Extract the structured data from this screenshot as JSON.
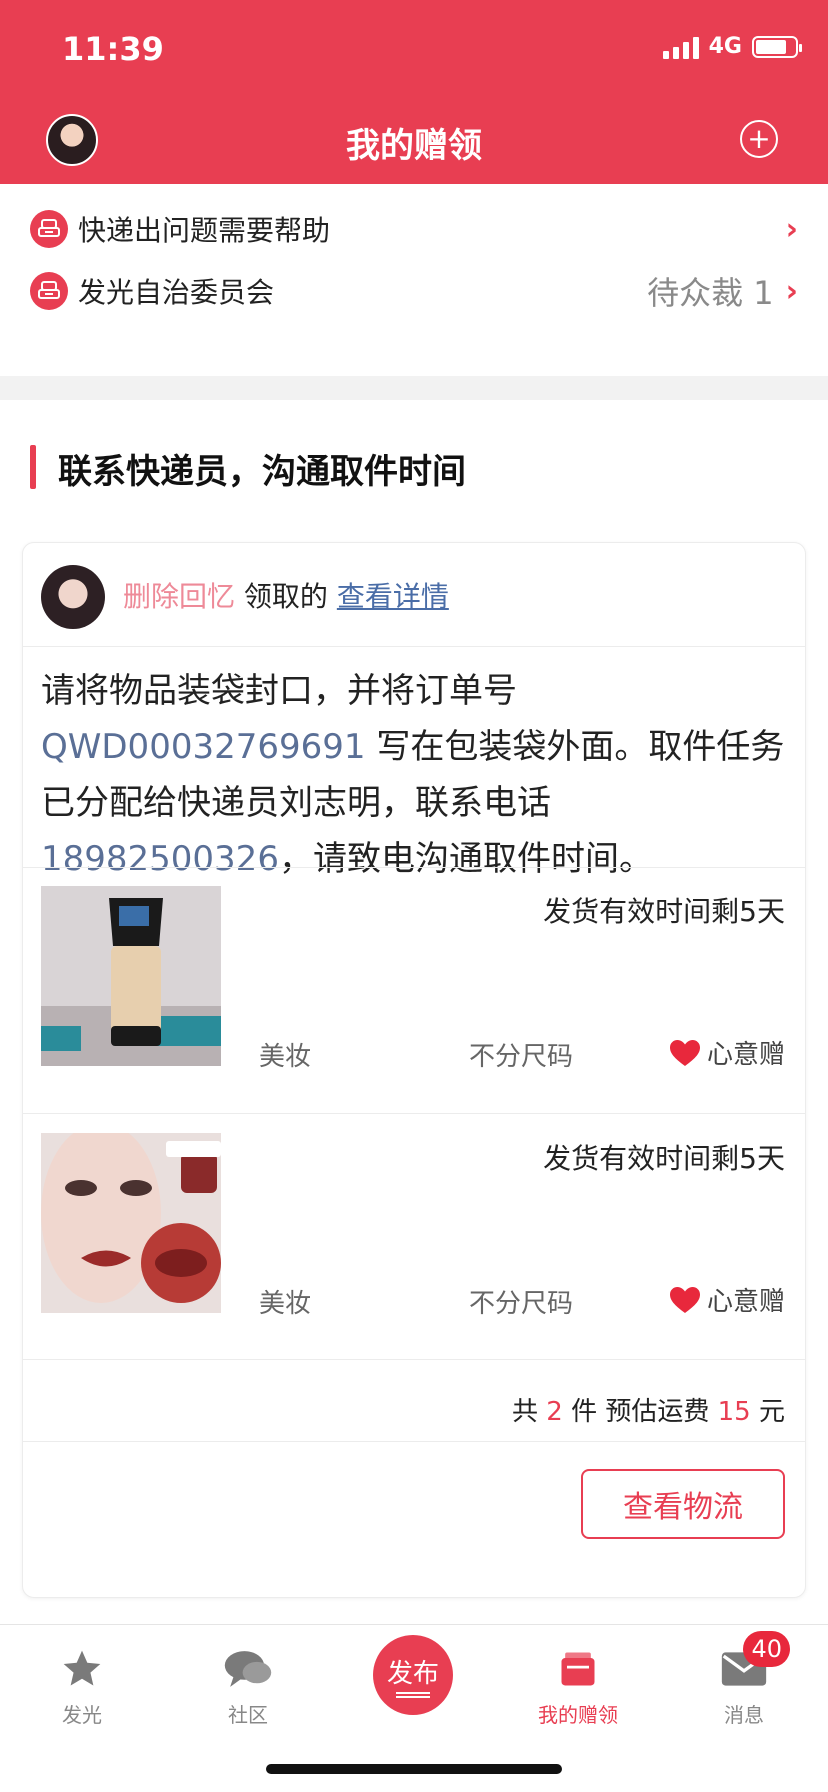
{
  "status": {
    "time": "11:39",
    "network": "4G"
  },
  "header": {
    "title": "我的赠领"
  },
  "quick_rows": [
    {
      "label": "快递出问题需要帮助",
      "right": ""
    },
    {
      "label": "发光自治委员会",
      "right": "待众裁 1"
    }
  ],
  "section": {
    "title": "联系快递员，沟通取件时间"
  },
  "card": {
    "user_name": "删除回忆",
    "got_text": "领取的",
    "detail_link": "查看详情",
    "message": {
      "p1": "请将物品装袋封口，并将订单号 ",
      "order_no": "QWD00032769691",
      "p2": " 写在包装袋外面。取件任务已分配给快递员刘志明，联系电话",
      "phone": "18982500326",
      "p3": "，请致电沟通取件时间。"
    },
    "items": [
      {
        "deadline": "发货有效时间剩5天",
        "category": "美妆",
        "size": "不分尺码",
        "gift": "心意赠"
      },
      {
        "deadline": "发货有效时间剩5天",
        "category": "美妆",
        "size": "不分尺码",
        "gift": "心意赠"
      }
    ],
    "summary": {
      "pre": "共 ",
      "count": "2",
      "mid": " 件 预估运费 ",
      "fee": "15",
      "post": " 元"
    },
    "logistics_button": "查看物流"
  },
  "tabbar": {
    "tabs": [
      {
        "label": "发光",
        "icon": "star-icon"
      },
      {
        "label": "社区",
        "icon": "chat-icon"
      },
      {
        "label": "发布",
        "icon": "publish-icon"
      },
      {
        "label": "我的赠领",
        "icon": "gift-box-icon"
      },
      {
        "label": "消息",
        "icon": "mail-icon"
      }
    ],
    "message_badge": "40"
  },
  "colors": {
    "accent": "#e83e52",
    "link": "#5a6f96"
  }
}
